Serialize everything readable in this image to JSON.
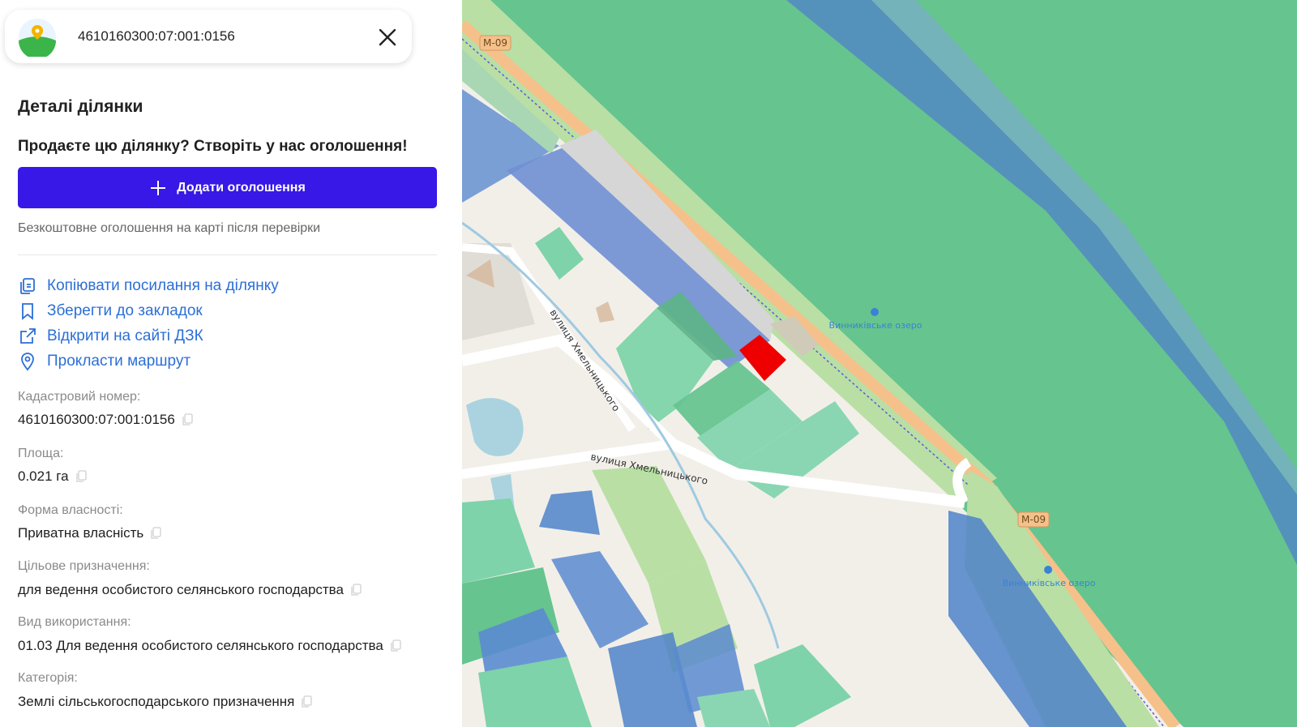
{
  "search": {
    "cadastral_query": "4610160300:07:001:0156"
  },
  "panel": {
    "title": "Деталі ділянки",
    "sell_prompt": "Продаєте цю ділянку? Створіть у нас оголошення!",
    "add_listing_label": "Додати оголошення",
    "free_note": "Безкоштовне оголошення на карті після перевірки",
    "actions": [
      {
        "label": "Копіювати посилання на ділянку",
        "icon": "copy-link-icon"
      },
      {
        "label": "Зберегти до закладок",
        "icon": "bookmark-icon"
      },
      {
        "label": "Відкрити на сайті ДЗК",
        "icon": "external-link-icon"
      },
      {
        "label": "Прокласти маршрут",
        "icon": "location-pin-icon"
      }
    ],
    "fields": [
      {
        "label": "Кадастровий номер:",
        "value": "4610160300:07:001:0156"
      },
      {
        "label": "Площа:",
        "value": "0.021 га"
      },
      {
        "label": "Форма власності:",
        "value": "Приватна власність"
      },
      {
        "label": "Цільове призначення:",
        "value": "для ведення особистого селянського господарства"
      },
      {
        "label": "Вид використання:",
        "value": "01.03 Для ведення особистого селянського господарства"
      },
      {
        "label": "Категорія:",
        "value": "Землі сільськогосподарського призначення"
      }
    ]
  },
  "map": {
    "road_labels": [
      "М-09",
      "М-09"
    ],
    "street_labels": [
      "вулиця Хмельницького",
      "вулиця Хмельницького"
    ],
    "poi_labels": [
      "Винниківське озеро",
      "Винниківське озеро"
    ],
    "colors": {
      "forest": "#66c48f",
      "state_land": "#6f8fd4",
      "agri_land": "#8ad6b3",
      "selected_parcel": "#ef0000",
      "motorway": "#f6c08a",
      "accent_button": "#3718e6",
      "link": "#2c6fd6"
    }
  }
}
